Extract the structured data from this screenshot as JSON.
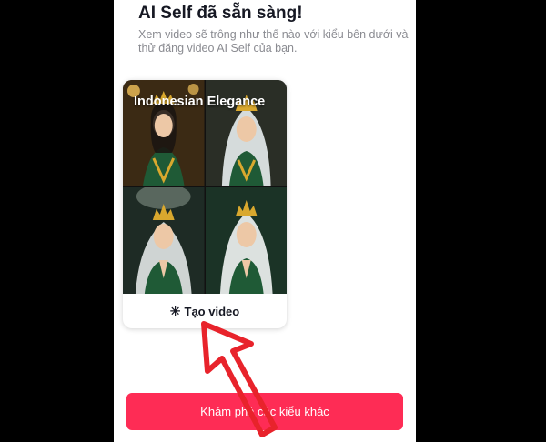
{
  "header": {
    "title": "AI Self đã sẵn sàng!",
    "subtitle": "Xem video sẽ trông như thế nào với kiểu bên dưới và thử đăng video AI Self của bạn."
  },
  "style_card": {
    "style_name": "Indonesian Elegance",
    "create_label": "Tạo video",
    "create_icon": "sparkle-icon",
    "preview_images": [
      "woman-in-gold-crown-green-dress",
      "woman-in-crown-white-veil",
      "woman-praying-gold-crown-veil",
      "woman-praying-crown-white-veil"
    ]
  },
  "footer": {
    "explore_label": "Khám phá các kiểu khác"
  },
  "colors": {
    "accent": "#fe2c55",
    "annotation_arrow": "#e8232b"
  }
}
